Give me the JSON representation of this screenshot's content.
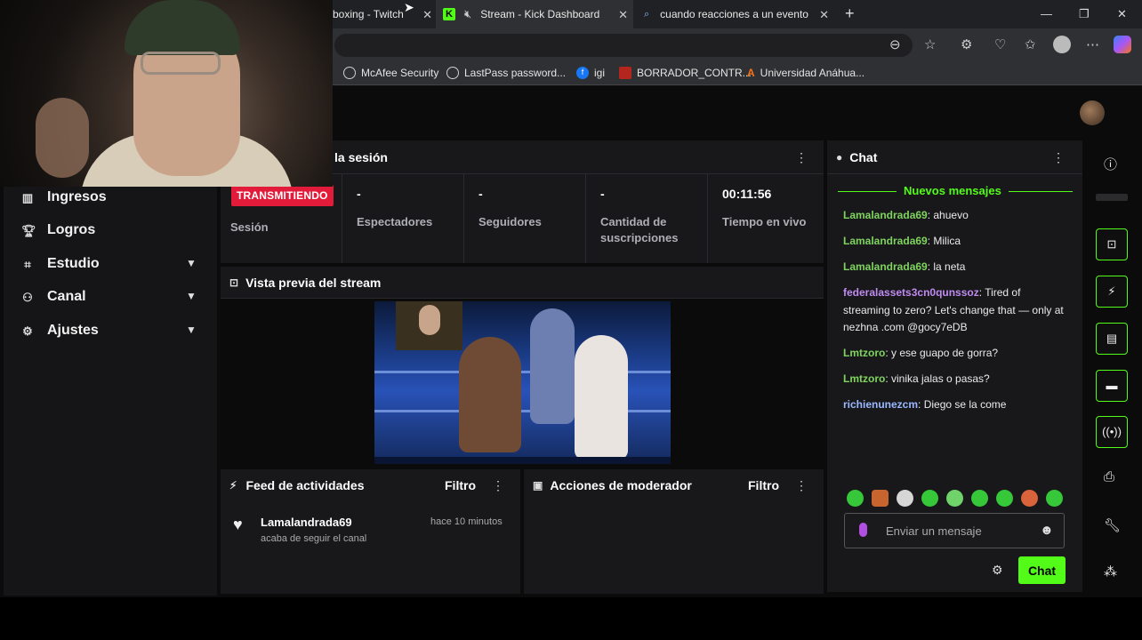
{
  "browser": {
    "tabs": [
      {
        "title": "boxing - Twitch"
      },
      {
        "title": "Stream - Kick Dashboard"
      },
      {
        "title": "cuando reacciones a un evento e"
      }
    ],
    "new_tab": "+",
    "bookmarks": [
      {
        "label": "McAfee Security"
      },
      {
        "label": "LastPass password..."
      },
      {
        "label": "igi"
      },
      {
        "label": "BORRADOR_CONTR..."
      },
      {
        "label": "Universidad Anáhua..."
      }
    ]
  },
  "sidebar": {
    "items": [
      {
        "label": "Ingresos",
        "icon": "bar-chart-icon"
      },
      {
        "label": "Logros",
        "icon": "trophy-icon"
      },
      {
        "label": "Estudio",
        "icon": "studio-icon"
      },
      {
        "label": "Canal",
        "icon": "channel-icon"
      },
      {
        "label": "Ajustes",
        "icon": "gear-icon"
      }
    ]
  },
  "session": {
    "title": "la sesión",
    "badge": "TRANSMITIENDO",
    "session_label": "Sesión",
    "stats": [
      {
        "value": "-",
        "label": "Espectadores"
      },
      {
        "value": "-",
        "label": "Seguidores"
      },
      {
        "value": "-",
        "label": "Cantidad de suscripciones"
      },
      {
        "value": "00:11:56",
        "label": "Tiempo en vivo"
      }
    ]
  },
  "preview": {
    "title": "Vista previa del stream"
  },
  "activity": {
    "title": "Feed de actividades",
    "filter": "Filtro",
    "items": [
      {
        "user": "Lamalandrada69",
        "time": "hace 10 minutos",
        "text": "acaba de seguir el canal"
      }
    ]
  },
  "moderator": {
    "title": "Acciones de moderador",
    "filter": "Filtro"
  },
  "chat": {
    "title": "Chat",
    "new_messages": "Nuevos mensajes",
    "messages": [
      {
        "user": "Lamalandrada69",
        "text": ": ahuevo",
        "color": "#7fd45e"
      },
      {
        "user": "Lamalandrada69",
        "text": ": Milica",
        "color": "#7fd45e"
      },
      {
        "user": "Lamalandrada69",
        "text": ": la neta",
        "color": "#7fd45e"
      },
      {
        "user": "federalassets3cn0qunssoz",
        "text": ": Tired of streaming to zero? Let's change that — only at nezhna .com @gocy7eDB",
        "color": "#c08bf0"
      },
      {
        "user": "Lmtzoro",
        "text": ": y ese guapo de gorra?",
        "color": "#7fd45e"
      },
      {
        "user": "Lmtzoro",
        "text": ": vinika jalas o pasas?",
        "color": "#7fd45e"
      },
      {
        "user": "richienunezcm",
        "text": ": Diego se la come",
        "color": "#9ab8ff"
      }
    ],
    "input_placeholder": "Enviar un mensaje",
    "send_label": "Chat"
  },
  "colors": {
    "accent": "#53fc18",
    "live": "#e31b3b"
  }
}
